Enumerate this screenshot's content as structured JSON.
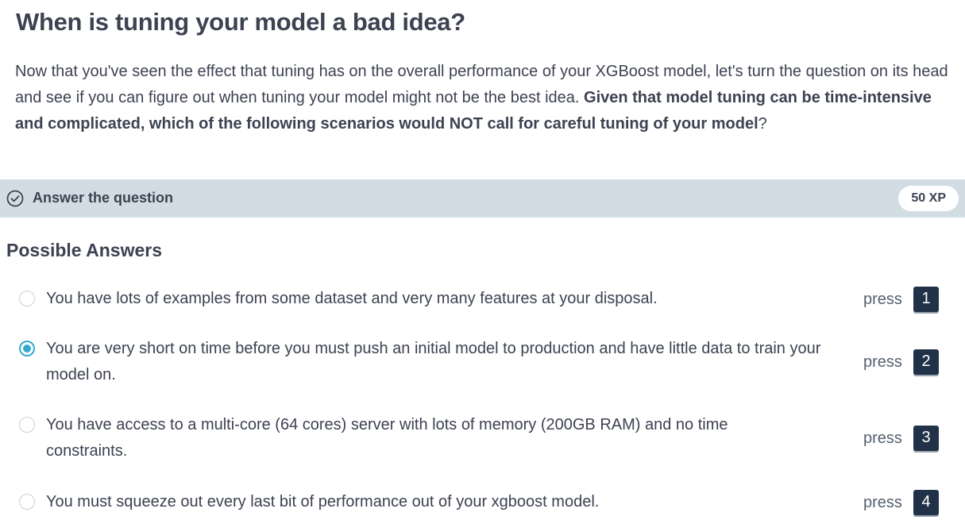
{
  "exercise": {
    "title": "When is tuning your model a bad idea?",
    "intro_plain": "Now that you've seen the effect that tuning has on the overall performance of your XGBoost model, let's turn the question on its head and see if you can figure out when tuning your model might not be the best idea. ",
    "intro_bold": "Given that model tuning can be time-intensive and complicated, which of the following scenarios would NOT call for careful tuning of your model",
    "intro_end": "?"
  },
  "question_bar": {
    "icon": "check-circle-icon",
    "label": "Answer the question",
    "xp": "50 XP"
  },
  "answers": {
    "heading": "Possible Answers",
    "selected_index": 1,
    "items": [
      {
        "text": "You have lots of examples from some dataset and very many features at your disposal.",
        "press_label": "press",
        "key": "1",
        "selected": false
      },
      {
        "text": "You are very short on time before you must push an initial model to production and have little data to train your model on.",
        "press_label": "press",
        "key": "2",
        "selected": true
      },
      {
        "text": "You have access to a multi-core (64 cores) server with lots of memory (200GB RAM) and no time constraints.",
        "press_label": "press",
        "key": "3",
        "selected": false
      },
      {
        "text": "You must squeeze out every last bit of performance out of your xgboost model.",
        "press_label": "press",
        "key": "4",
        "selected": false
      }
    ]
  },
  "colors": {
    "bar_bg": "#d1dde3",
    "text": "#3d4251",
    "radio_selected": "#33aacc",
    "key_bg": "#213147"
  }
}
